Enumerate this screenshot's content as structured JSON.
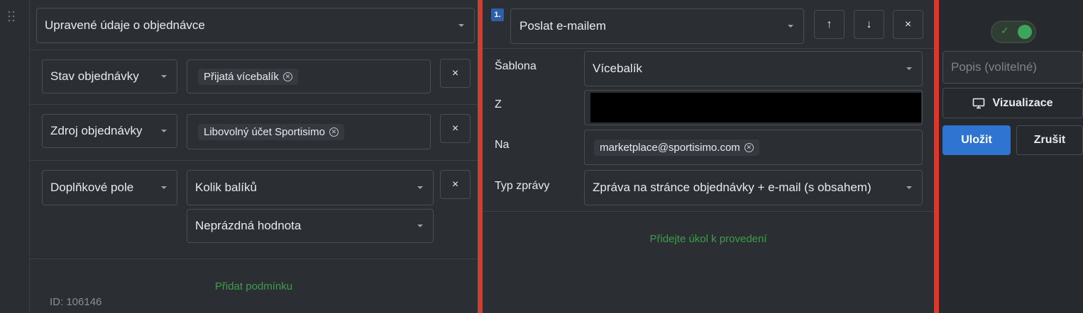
{
  "conditions": {
    "group_select": "Upravené údaje o objednávce",
    "rows": [
      {
        "field": "Stav objednávky",
        "chip": "Přijatá vícebalík"
      },
      {
        "field": "Zdroj objednávky",
        "chip": "Libovolný účet Sportisimo"
      },
      {
        "field": "Doplňkové pole",
        "value": "Kolik balíků",
        "operator": "Neprázdná hodnota"
      }
    ],
    "add_condition": "Přidat podmínku",
    "id_text": "ID: 106146",
    "remove_glyph": "×"
  },
  "action": {
    "step_number": "1.",
    "type": "Poslat e-mailem",
    "up_glyph": "↑",
    "down_glyph": "↓",
    "close_glyph": "×",
    "template_label": "Šablona",
    "template_value": "Vícebalík",
    "from_label": "Z",
    "to_label": "Na",
    "to_chip": "marketplace@sportisimo.com",
    "message_type_label": "Typ zprávy",
    "message_type_value": "Zpráva na stránce objednávky + e-mail (s obsahem)",
    "add_task": "Přidejte úkol k provedení"
  },
  "side": {
    "toggle_on": true,
    "description_placeholder": "Popis (volitelné)",
    "visualize": "Vizualizace",
    "save": "Uložit",
    "cancel": "Zrušit"
  },
  "colors": {
    "accent_blue": "#2f74d0",
    "divider_red": "#d63a2f",
    "link_green": "#3f9d4a",
    "toggle_green": "#3ba55c"
  }
}
